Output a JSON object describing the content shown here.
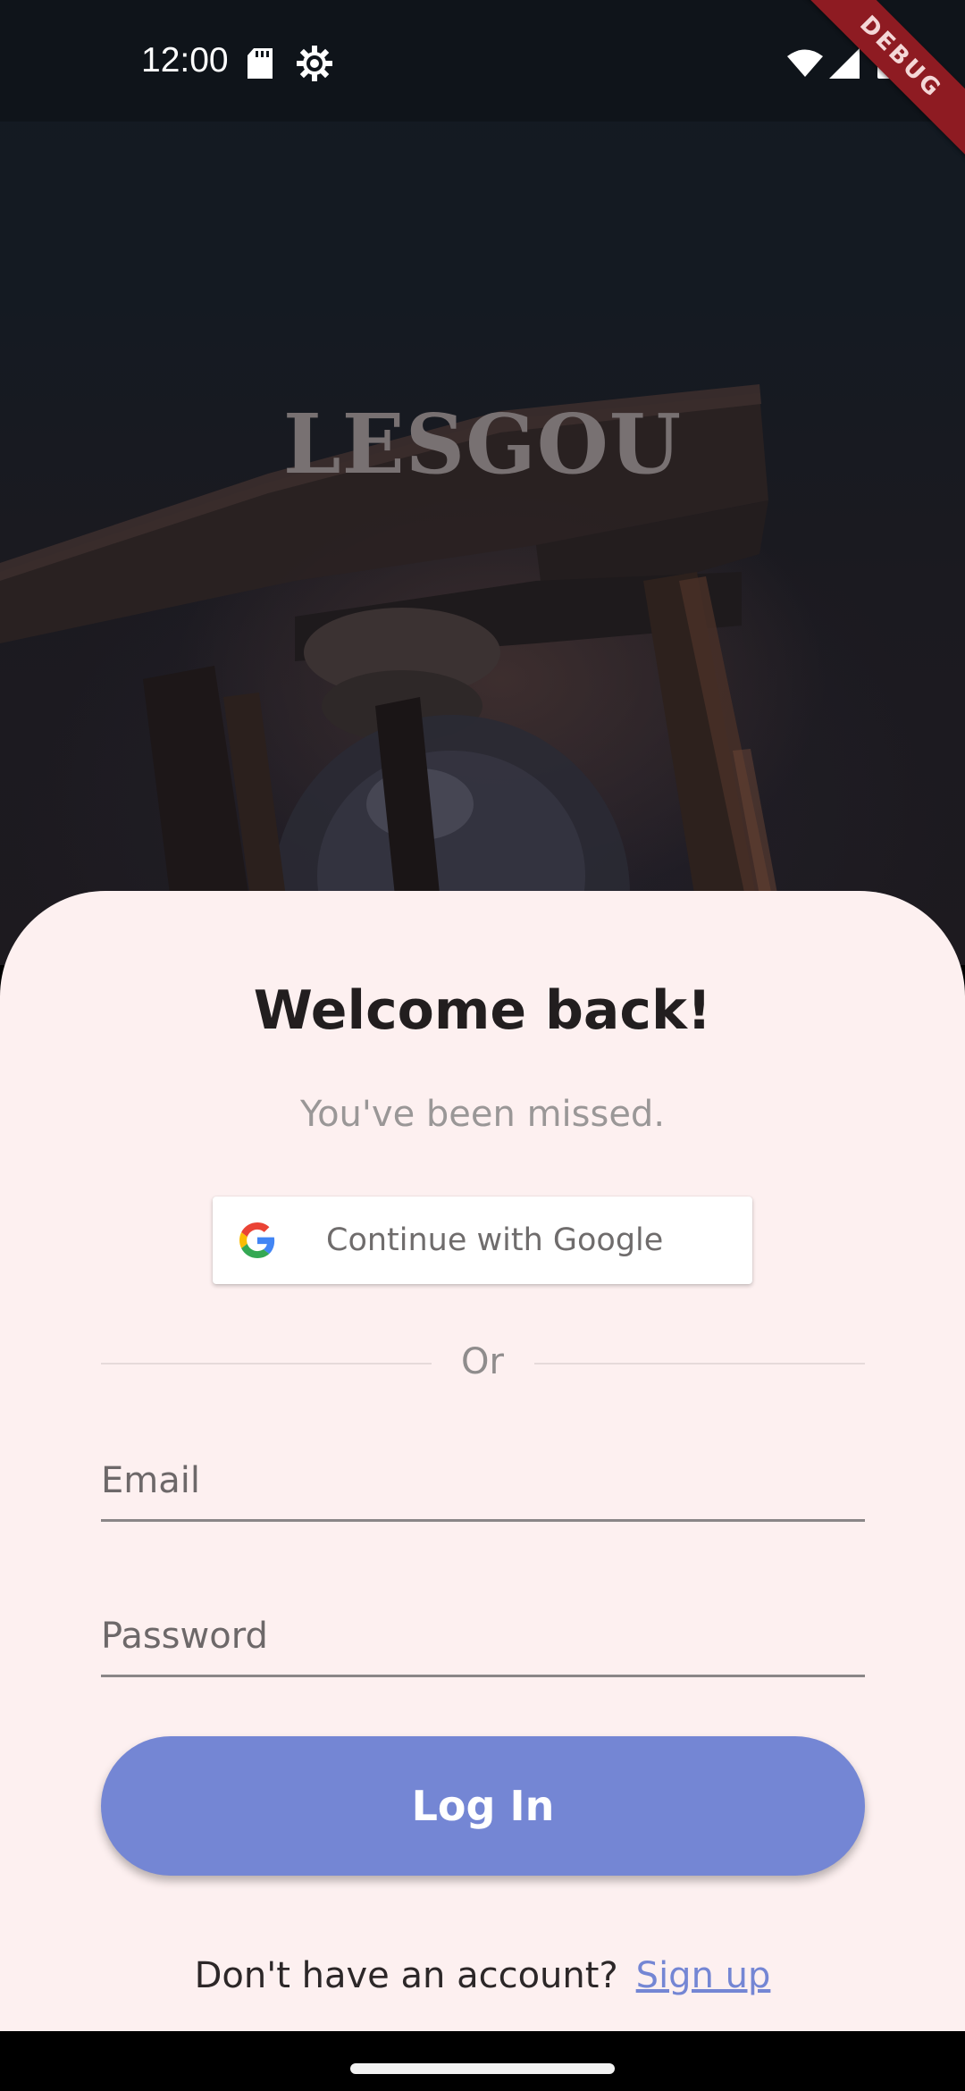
{
  "status_bar": {
    "time": "12:00",
    "icons": [
      "sd-card-icon",
      "settings-gear-icon",
      "wifi-icon",
      "signal-icon",
      "battery-icon"
    ],
    "debug_label": "DEBUG"
  },
  "hero": {
    "app_name": "LESGOU",
    "background_image": "hourglass"
  },
  "login": {
    "title": "Welcome back!",
    "subtitle": "You've been missed.",
    "google_button_label": "Continue with Google",
    "divider_text": "Or",
    "email_placeholder": "Email",
    "password_placeholder": "Password",
    "login_button_label": "Log In",
    "signup_prompt": "Don't have an account?",
    "signup_link": "Sign up"
  },
  "colors": {
    "accent": "#7486d4",
    "sheet_background": "#fdf0f0",
    "debug_banner": "#8e1b22"
  }
}
